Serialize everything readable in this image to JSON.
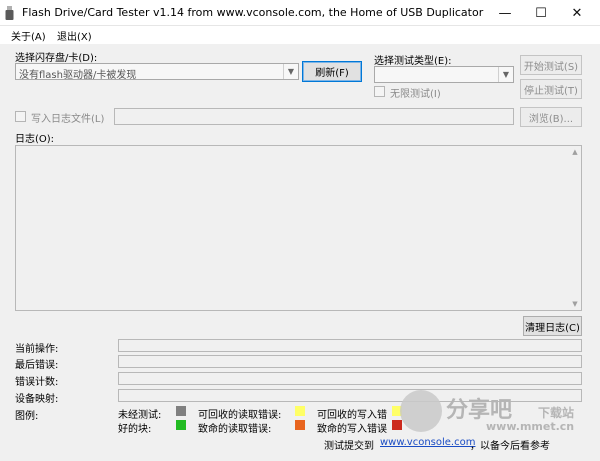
{
  "window": {
    "title": "Flash Drive/Card Tester v1.14 from www.vconsole.com, the Home of USB Duplicator",
    "controls": {
      "minimize": "—",
      "maximize": "☐",
      "close": "✕"
    }
  },
  "menu": {
    "about": "关于(A)",
    "exit": "退出(X)"
  },
  "drive": {
    "label": "选择闪存盘/卡(D):",
    "value": "没有flash驱动器/卡被发现",
    "refresh_button": "刷新(F)"
  },
  "test_type": {
    "label": "选择测试类型(E):",
    "value": "",
    "infinite_label": "无限测试(I)"
  },
  "buttons": {
    "start": "开始测试(S)",
    "stop": "停止测试(T)",
    "browse": "浏览(B)...",
    "clear_log": "清理日志(C)"
  },
  "log_file": {
    "label": "写入日志文件(L)",
    "value": ""
  },
  "log": {
    "label": "日志(O):"
  },
  "status": {
    "current_op": "当前操作:",
    "last_error": "最后错误:",
    "error_count": "错误计数:",
    "device_map": "设备映射:"
  },
  "legend": {
    "label": "图例:",
    "items": [
      {
        "text": "未经测试:",
        "color": "#808080"
      },
      {
        "text": "好的块:",
        "color": "#22bb22"
      },
      {
        "text": "可回收的读取错误:",
        "color": "#ffff66"
      },
      {
        "text": "致命的读取错误:",
        "color": "#e8641e"
      },
      {
        "text": "可回收的写入错",
        "color": "#ffff66"
      },
      {
        "text": "致命的写入错误",
        "color": "#cc2a1e"
      }
    ]
  },
  "footer": {
    "submit_text": "测试提交到",
    "link_text": "www.vconsole.com",
    "suffix_text": "，以备今后看参考"
  },
  "watermark": {
    "brand": "分享吧",
    "sub": "下载站",
    "url": "www.mmet.cn"
  },
  "colors": {
    "accent": "#0078d7",
    "link": "#1a4cc4"
  }
}
